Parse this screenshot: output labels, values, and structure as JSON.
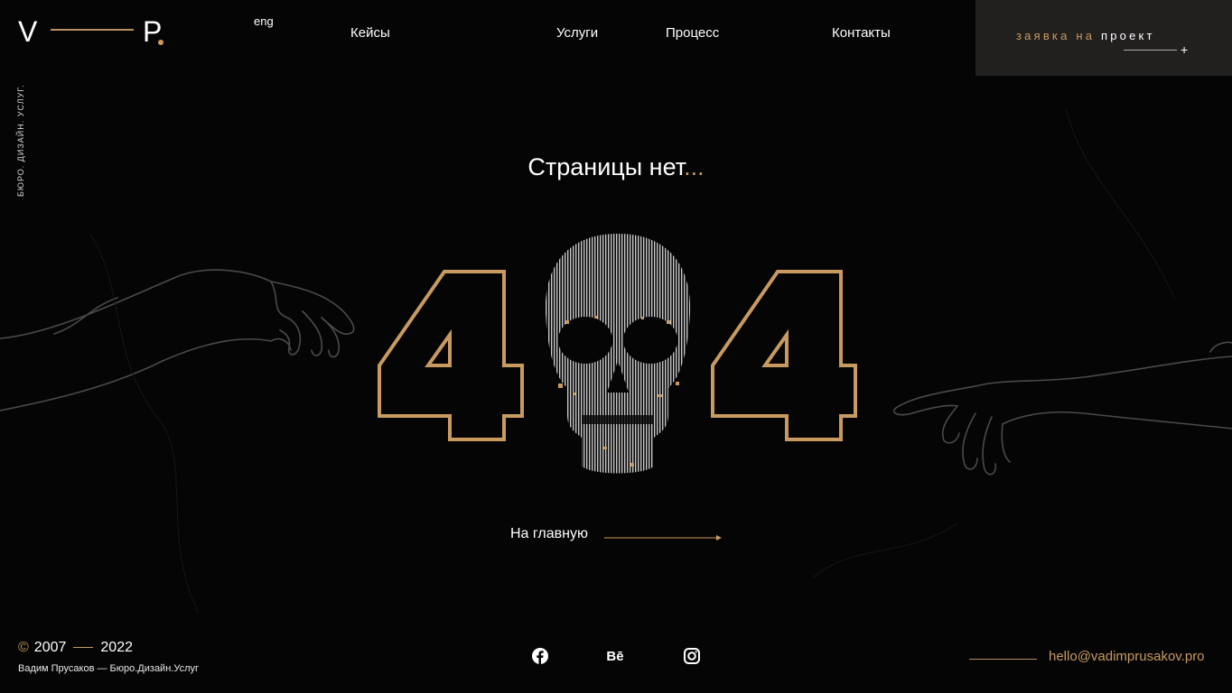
{
  "logo": {
    "left": "V",
    "right": "P"
  },
  "tagline": "БЮРО. ДИЗАЙН. УСЛУГ.",
  "lang": "eng",
  "nav": [
    {
      "label": "Кейсы"
    },
    {
      "label": "Услуги"
    },
    {
      "label": "Процесс"
    },
    {
      "label": "Контакты"
    }
  ],
  "cta": {
    "part1": "заявка на",
    "part2": "проект",
    "plus": "+"
  },
  "error": {
    "title": "Страницы нет",
    "ellipsis": "...",
    "code_left": "4",
    "code_right": "4",
    "skull_icon": "skull-icon"
  },
  "home_link": "На главную",
  "footer": {
    "copyright_symbol": "©",
    "year_start": "2007",
    "year_end": "2022",
    "subtitle": "Вадим Прусаков — Бюро.Дизайн.Услуг",
    "social": [
      "facebook-icon",
      "behance-icon",
      "instagram-icon"
    ],
    "behance_label": "Bē",
    "email": "hello@vadimprusakov.pro"
  },
  "colors": {
    "accent": "#c99a60",
    "background": "#050505",
    "cta_bg": "#221f1f"
  }
}
